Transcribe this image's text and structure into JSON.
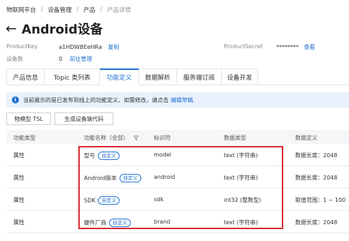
{
  "breadcrumb": [
    "物联网平台",
    "设备管理",
    "产品",
    "产品详情"
  ],
  "title": "Android设备",
  "meta": {
    "product_key_label": "ProductKey",
    "product_key_value": "a1HDWBEeHRa",
    "copy_label": "复制",
    "device_count_label": "设备数",
    "device_count_value": "0",
    "manage_link": "前往管理",
    "product_secret_label": "ProductSecret",
    "product_secret_value": "********",
    "view_link": "查看"
  },
  "tabs": [
    "产品信息",
    "Topic 类列表",
    "功能定义",
    "数据解析",
    "服务端订阅",
    "设备开发"
  ],
  "active_tab": "功能定义",
  "notice": {
    "text": "当前展示的是已发布到线上的功能定义，如需修改，请点击",
    "link": "编辑草稿"
  },
  "buttons": {
    "tsl": "物模型 TSL",
    "gen_code": "生成设备端代码"
  },
  "table": {
    "headers": [
      "功能类型",
      "功能名称（全部）",
      "标识符",
      "数据类型",
      "数据定义"
    ],
    "rows": [
      {
        "type": "属性",
        "name": "型号",
        "tag": "自定义",
        "id": "model",
        "dtype": "text (字符串)",
        "def": "数据长度：2048"
      },
      {
        "type": "属性",
        "name": "Android版本",
        "tag": "自定义",
        "id": "android",
        "dtype": "text (字符串)",
        "def": "数据长度：2048"
      },
      {
        "type": "属性",
        "name": "SDK",
        "tag": "自定义",
        "id": "sdk",
        "dtype": "int32 (整数型)",
        "def": "取值范围：1 ~ 100"
      },
      {
        "type": "属性",
        "name": "硬件厂商",
        "tag": "自定义",
        "id": "brand",
        "dtype": "text (字符串)",
        "def": "数据长度：2048"
      }
    ]
  },
  "colors": {
    "accent": "#1f6fd1",
    "highlight": "#d9252e",
    "notice_bg": "#e8f1fd"
  }
}
